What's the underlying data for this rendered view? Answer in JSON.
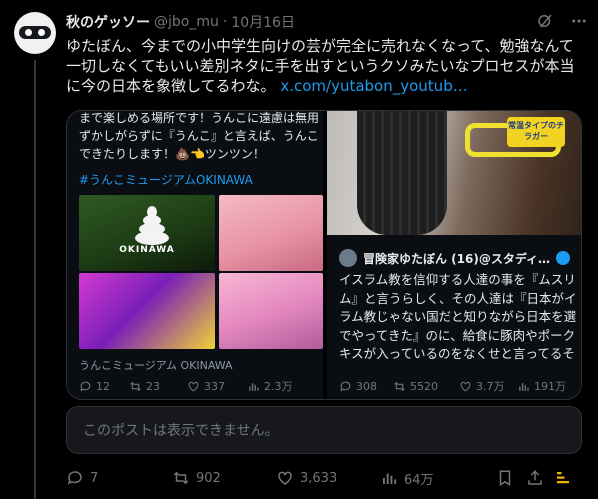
{
  "tweet": {
    "display_name": "秋のゲッソー",
    "handle": "@jbo_mu",
    "separator": "·",
    "date": "10月16日",
    "body_line1": "ゆたぼん、今までの小中学生向けの芸が完全に売れなくなって、勉強なんて",
    "body_line2": "一切しなくてもいい差別ネタに手を出すというクソみたいなプロセスが本当",
    "body_line3": "に今の日本を象徴してるわな。",
    "link": "x.com/yutabon_youtub…"
  },
  "quote_left": {
    "line1": "まで楽しめる場所です！うんこに遠慮は無用",
    "line2": "ずかしがらずに『うんこ』と言えば、うんこ",
    "line3": "できたりします！💩👈ツンツン！",
    "hashtag": "#うんこミュージアムOKINAWA",
    "thumb_label": "OKINAWA",
    "caption": "うんこミュージアム OKINAWA",
    "stats": {
      "replies": "12",
      "reposts": "23",
      "likes": "337",
      "views": "2.3万"
    }
  },
  "quote_right": {
    "label_text": "常温タイプのチラガー",
    "author": "冒険家ゆたぼん (16)@スタディ…",
    "line1": "イスラム教を信仰する人達の事を『ムスリ",
    "line2": "ム』と言うらしく、その人達は『日本がイ",
    "line3": "ラム教じゃない国だと知りながら日本を選",
    "line4": "でやってきた』のに、給食に豚肉やポーク",
    "line5": "キスが入っているのをなくせと言ってるそ",
    "stats": {
      "replies": "308",
      "reposts": "5520",
      "likes": "3.7万",
      "views": "191万"
    }
  },
  "unavailable_text": "このポストは表示できません。",
  "actions": {
    "replies": "7",
    "reposts": "902",
    "likes": "3,633",
    "views": "64万"
  },
  "colors": {
    "accent": "#1d9bf0",
    "muted": "#71767b",
    "background": "#000000"
  }
}
